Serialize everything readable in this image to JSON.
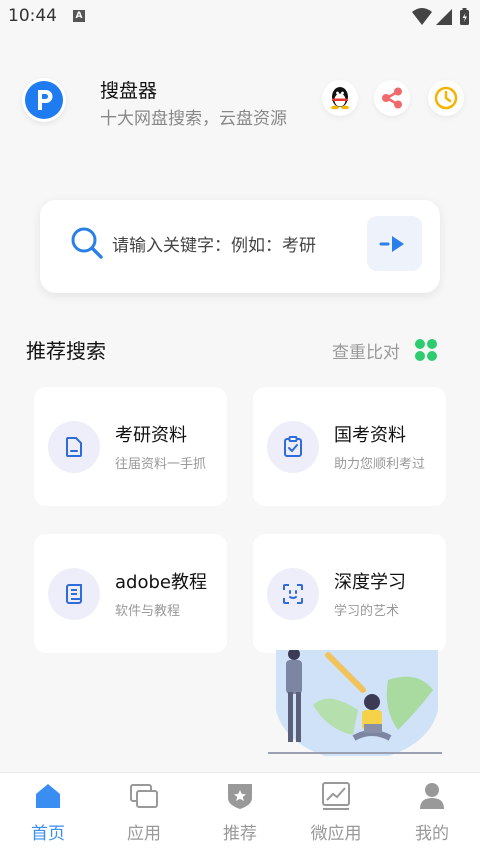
{
  "status_bar": {
    "time": "10:44",
    "a_badge": "A"
  },
  "header": {
    "title": "搜盘器",
    "subtitle": "十大网盘搜索，云盘资源",
    "logo_letter": "P"
  },
  "search": {
    "placeholder": "请输入关键字：例如：考研"
  },
  "section": {
    "title": "推荐搜索",
    "compare_label": "查重比对"
  },
  "cards": [
    {
      "title": "考研资料",
      "subtitle": "往届资料一手抓",
      "icon": "document-icon"
    },
    {
      "title": "国考资料",
      "subtitle": "助力您顺利考过",
      "icon": "clipboard-check-icon"
    },
    {
      "title": "adobe教程",
      "subtitle": "软件与教程",
      "icon": "scroll-icon"
    },
    {
      "title": "深度学习",
      "subtitle": "学习的艺术",
      "icon": "face-scan-icon"
    }
  ],
  "nav": [
    {
      "label": "首页",
      "icon": "home-icon",
      "active": true
    },
    {
      "label": "应用",
      "icon": "apps-icon"
    },
    {
      "label": "推荐",
      "icon": "badge-star-icon"
    },
    {
      "label": "微应用",
      "icon": "chart-icon"
    },
    {
      "label": "我的",
      "icon": "user-icon"
    }
  ],
  "colors": {
    "accent": "#3a8ef2",
    "logo_blue": "#1e7bf0",
    "share": "#f16a6a",
    "clock": "#f5b400",
    "clover": "#2ecc71",
    "icon_blue": "#2f6bd9"
  }
}
